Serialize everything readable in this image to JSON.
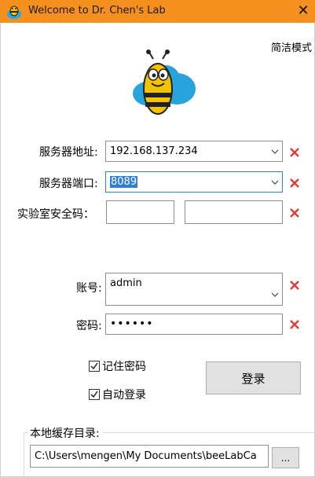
{
  "window": {
    "title": "Welcome to Dr. Chen's Lab",
    "close_label": "✕",
    "simple_mode_label": "简洁模式"
  },
  "form": {
    "server_address": {
      "label": "服务器地址:",
      "value": "192.168.137.234"
    },
    "server_port": {
      "label": "服务器端口:",
      "value": "8089"
    },
    "lab_code": {
      "label": "实验室安全码：",
      "value_1": "",
      "value_2": ""
    },
    "account": {
      "label": "账号:",
      "value": "admin"
    },
    "password": {
      "label": "密码:",
      "value": "••••••"
    }
  },
  "options": {
    "remember_password": {
      "label": "记住密码",
      "checked": true
    },
    "auto_login": {
      "label": "自动登录",
      "checked": true
    }
  },
  "login_button_label": "登录",
  "cache": {
    "group_title": "本地缓存目录:",
    "path": "C:\\Users\\mengen\\My Documents\\beeLabCa",
    "browse_label": "..."
  },
  "colors": {
    "titlebar": "#f5901e",
    "clear_icon": "#e53935",
    "focus_border": "#2f7fd6"
  }
}
